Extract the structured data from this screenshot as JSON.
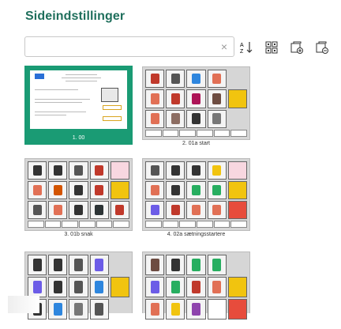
{
  "title": "Sideindstillinger",
  "search": {
    "placeholder": "",
    "clear_icon": "×"
  },
  "toolbar": {
    "sort_icon": "sort-az-icon",
    "grid_icon": "qr-grid-icon",
    "copy_icon": "copy-page-icon",
    "paste_icon": "paste-page-icon"
  },
  "pages": [
    {
      "label": "1. 00",
      "selected": true
    },
    {
      "label": "2. 01a start",
      "selected": false
    },
    {
      "label": "3. 01b snak",
      "selected": false
    },
    {
      "label": "4. 02a sætningsstartere",
      "selected": false
    },
    {
      "label": "",
      "selected": false
    },
    {
      "label": "",
      "selected": false
    }
  ],
  "colors": {
    "accent": "#1a9b74",
    "title": "#1f6f5c"
  }
}
